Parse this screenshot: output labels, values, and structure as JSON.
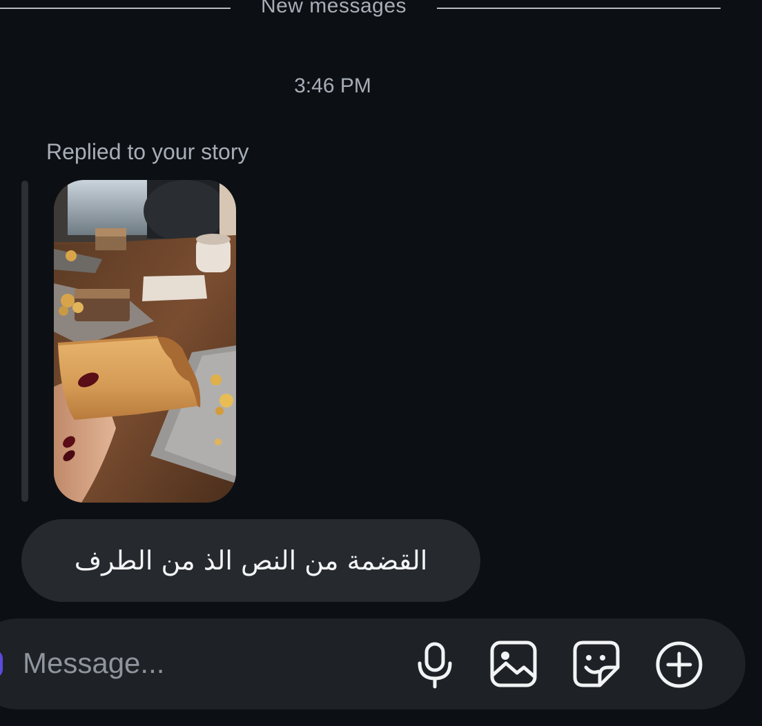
{
  "divider": {
    "label": "New messages"
  },
  "thread": {
    "timestamp": "3:46 PM",
    "reply_context": "Replied to your story",
    "message_text": "القضمة من النص الذ من الطرف"
  },
  "composer": {
    "placeholder": "Message...",
    "icons": [
      "microphone-icon",
      "gallery-icon",
      "sticker-icon",
      "plus-circle-icon"
    ]
  },
  "colors": {
    "background": "#0c1014",
    "bubble": "#262a2f",
    "composer": "#1e2226",
    "muted_text": "#a8aeb7",
    "message_text": "#f4f5f6"
  }
}
